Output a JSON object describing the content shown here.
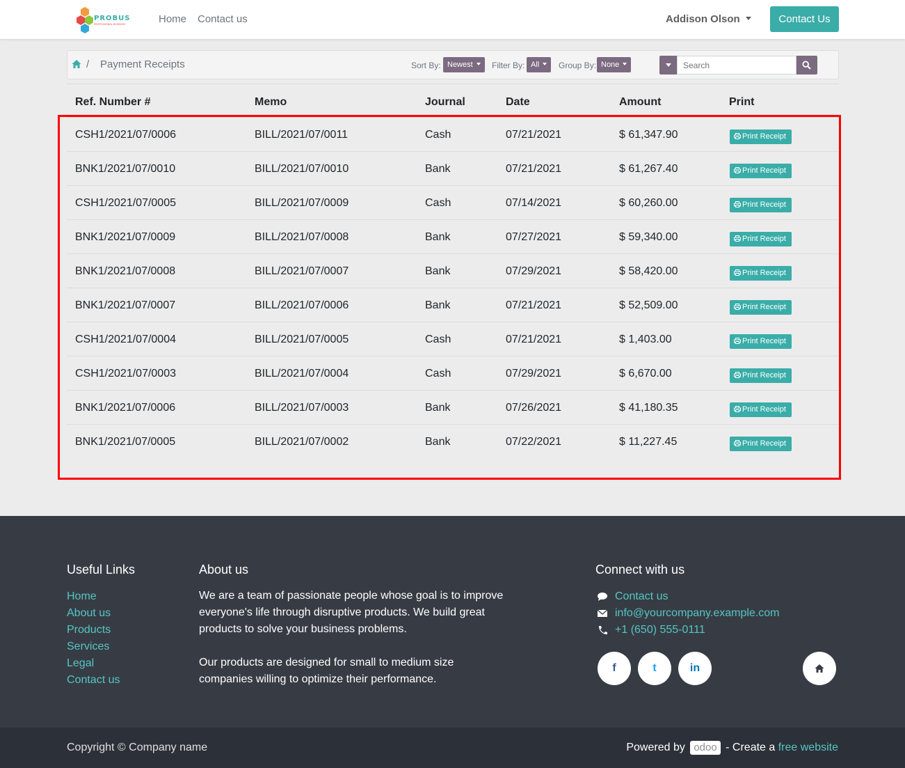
{
  "header": {
    "logo_text": "PROBUSE",
    "logo_sub": "PROFESSIONAL BUSINESS",
    "nav": [
      "Home",
      "Contact us"
    ],
    "user": "Addison Olson",
    "contact_button": "Contact Us"
  },
  "breadcrumb": {
    "title": "Payment Receipts",
    "separator": "/",
    "sort_label": "Sort By:",
    "sort_value": "Newest",
    "filter_label": "Filter By:",
    "filter_value": "All",
    "group_label": "Group By:",
    "group_value": "None",
    "search_placeholder": "Search"
  },
  "table": {
    "headers": [
      "Ref. Number #",
      "Memo",
      "Journal",
      "Date",
      "Amount",
      "Print"
    ],
    "print_label": "Print Receipt",
    "rows": [
      {
        "ref": "CSH1/2021/07/0006",
        "memo": "BILL/2021/07/0011",
        "journal": "Cash",
        "date": "07/21/2021",
        "amount": "$ 61,347.90"
      },
      {
        "ref": "BNK1/2021/07/0010",
        "memo": "BILL/2021/07/0010",
        "journal": "Bank",
        "date": "07/21/2021",
        "amount": "$ 61,267.40"
      },
      {
        "ref": "CSH1/2021/07/0005",
        "memo": "BILL/2021/07/0009",
        "journal": "Cash",
        "date": "07/14/2021",
        "amount": "$ 60,260.00"
      },
      {
        "ref": "BNK1/2021/07/0009",
        "memo": "BILL/2021/07/0008",
        "journal": "Bank",
        "date": "07/27/2021",
        "amount": "$ 59,340.00"
      },
      {
        "ref": "BNK1/2021/07/0008",
        "memo": "BILL/2021/07/0007",
        "journal": "Bank",
        "date": "07/29/2021",
        "amount": "$ 58,420.00"
      },
      {
        "ref": "BNK1/2021/07/0007",
        "memo": "BILL/2021/07/0006",
        "journal": "Bank",
        "date": "07/21/2021",
        "amount": "$ 52,509.00"
      },
      {
        "ref": "CSH1/2021/07/0004",
        "memo": "BILL/2021/07/0005",
        "journal": "Cash",
        "date": "07/21/2021",
        "amount": "$ 1,403.00"
      },
      {
        "ref": "CSH1/2021/07/0003",
        "memo": "BILL/2021/07/0004",
        "journal": "Cash",
        "date": "07/29/2021",
        "amount": "$ 6,670.00"
      },
      {
        "ref": "BNK1/2021/07/0006",
        "memo": "BILL/2021/07/0003",
        "journal": "Bank",
        "date": "07/26/2021",
        "amount": "$ 41,180.35"
      },
      {
        "ref": "BNK1/2021/07/0005",
        "memo": "BILL/2021/07/0002",
        "journal": "Bank",
        "date": "07/22/2021",
        "amount": "$ 11,227.45"
      }
    ]
  },
  "footer": {
    "useful_links_title": "Useful Links",
    "useful_links": [
      "Home",
      "About us",
      "Products",
      "Services",
      "Legal",
      "Contact us"
    ],
    "about_title": "About us",
    "about_lines_1": [
      "We are a team of passionate people whose goal is to improve",
      "everyone's life through disruptive products. We build great",
      "products to solve your business problems."
    ],
    "about_lines_2": [
      "Our products are designed for small to medium size",
      "companies willing to optimize their performance."
    ],
    "connect_title": "Connect with us",
    "contact_link": "Contact us",
    "email": "info@yourcompany.example.com",
    "phone": "+1 (650) 555-0111",
    "social": [
      "f",
      "t",
      "in"
    ],
    "copyright": "Copyright © Company name",
    "powered_by": "Powered by",
    "odoo": "odoo",
    "create_text": "- Create a",
    "free_website": "free website"
  },
  "colors": {
    "accent": "#3aada8",
    "filter_button": "#7c6a80",
    "footer_bg": "#373c44",
    "link": "#56c5c4",
    "highlight": "#ff0000"
  }
}
